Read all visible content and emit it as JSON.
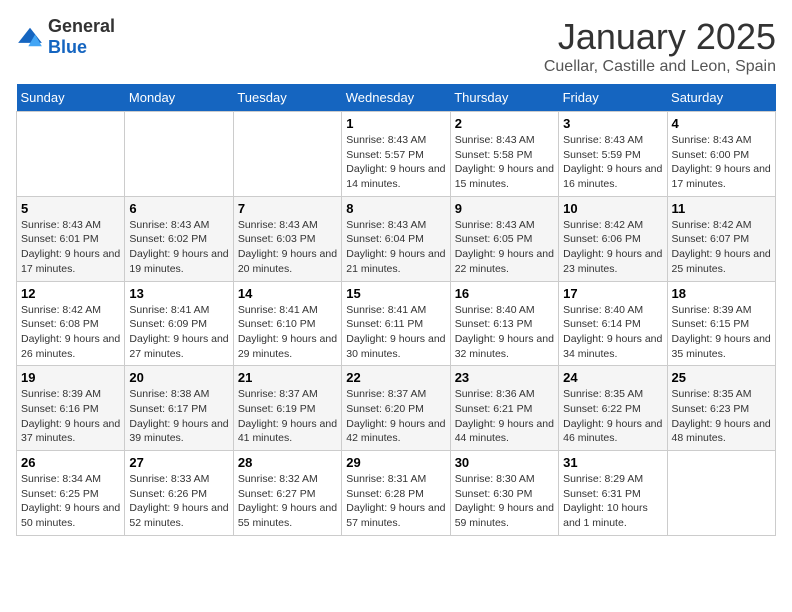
{
  "header": {
    "logo_general": "General",
    "logo_blue": "Blue",
    "month": "January 2025",
    "location": "Cuellar, Castille and Leon, Spain"
  },
  "weekdays": [
    "Sunday",
    "Monday",
    "Tuesday",
    "Wednesday",
    "Thursday",
    "Friday",
    "Saturday"
  ],
  "weeks": [
    [
      {
        "day": "",
        "info": ""
      },
      {
        "day": "",
        "info": ""
      },
      {
        "day": "",
        "info": ""
      },
      {
        "day": "1",
        "info": "Sunrise: 8:43 AM\nSunset: 5:57 PM\nDaylight: 9 hours and 14 minutes."
      },
      {
        "day": "2",
        "info": "Sunrise: 8:43 AM\nSunset: 5:58 PM\nDaylight: 9 hours and 15 minutes."
      },
      {
        "day": "3",
        "info": "Sunrise: 8:43 AM\nSunset: 5:59 PM\nDaylight: 9 hours and 16 minutes."
      },
      {
        "day": "4",
        "info": "Sunrise: 8:43 AM\nSunset: 6:00 PM\nDaylight: 9 hours and 17 minutes."
      }
    ],
    [
      {
        "day": "5",
        "info": "Sunrise: 8:43 AM\nSunset: 6:01 PM\nDaylight: 9 hours and 17 minutes."
      },
      {
        "day": "6",
        "info": "Sunrise: 8:43 AM\nSunset: 6:02 PM\nDaylight: 9 hours and 19 minutes."
      },
      {
        "day": "7",
        "info": "Sunrise: 8:43 AM\nSunset: 6:03 PM\nDaylight: 9 hours and 20 minutes."
      },
      {
        "day": "8",
        "info": "Sunrise: 8:43 AM\nSunset: 6:04 PM\nDaylight: 9 hours and 21 minutes."
      },
      {
        "day": "9",
        "info": "Sunrise: 8:43 AM\nSunset: 6:05 PM\nDaylight: 9 hours and 22 minutes."
      },
      {
        "day": "10",
        "info": "Sunrise: 8:42 AM\nSunset: 6:06 PM\nDaylight: 9 hours and 23 minutes."
      },
      {
        "day": "11",
        "info": "Sunrise: 8:42 AM\nSunset: 6:07 PM\nDaylight: 9 hours and 25 minutes."
      }
    ],
    [
      {
        "day": "12",
        "info": "Sunrise: 8:42 AM\nSunset: 6:08 PM\nDaylight: 9 hours and 26 minutes."
      },
      {
        "day": "13",
        "info": "Sunrise: 8:41 AM\nSunset: 6:09 PM\nDaylight: 9 hours and 27 minutes."
      },
      {
        "day": "14",
        "info": "Sunrise: 8:41 AM\nSunset: 6:10 PM\nDaylight: 9 hours and 29 minutes."
      },
      {
        "day": "15",
        "info": "Sunrise: 8:41 AM\nSunset: 6:11 PM\nDaylight: 9 hours and 30 minutes."
      },
      {
        "day": "16",
        "info": "Sunrise: 8:40 AM\nSunset: 6:13 PM\nDaylight: 9 hours and 32 minutes."
      },
      {
        "day": "17",
        "info": "Sunrise: 8:40 AM\nSunset: 6:14 PM\nDaylight: 9 hours and 34 minutes."
      },
      {
        "day": "18",
        "info": "Sunrise: 8:39 AM\nSunset: 6:15 PM\nDaylight: 9 hours and 35 minutes."
      }
    ],
    [
      {
        "day": "19",
        "info": "Sunrise: 8:39 AM\nSunset: 6:16 PM\nDaylight: 9 hours and 37 minutes."
      },
      {
        "day": "20",
        "info": "Sunrise: 8:38 AM\nSunset: 6:17 PM\nDaylight: 9 hours and 39 minutes."
      },
      {
        "day": "21",
        "info": "Sunrise: 8:37 AM\nSunset: 6:19 PM\nDaylight: 9 hours and 41 minutes."
      },
      {
        "day": "22",
        "info": "Sunrise: 8:37 AM\nSunset: 6:20 PM\nDaylight: 9 hours and 42 minutes."
      },
      {
        "day": "23",
        "info": "Sunrise: 8:36 AM\nSunset: 6:21 PM\nDaylight: 9 hours and 44 minutes."
      },
      {
        "day": "24",
        "info": "Sunrise: 8:35 AM\nSunset: 6:22 PM\nDaylight: 9 hours and 46 minutes."
      },
      {
        "day": "25",
        "info": "Sunrise: 8:35 AM\nSunset: 6:23 PM\nDaylight: 9 hours and 48 minutes."
      }
    ],
    [
      {
        "day": "26",
        "info": "Sunrise: 8:34 AM\nSunset: 6:25 PM\nDaylight: 9 hours and 50 minutes."
      },
      {
        "day": "27",
        "info": "Sunrise: 8:33 AM\nSunset: 6:26 PM\nDaylight: 9 hours and 52 minutes."
      },
      {
        "day": "28",
        "info": "Sunrise: 8:32 AM\nSunset: 6:27 PM\nDaylight: 9 hours and 55 minutes."
      },
      {
        "day": "29",
        "info": "Sunrise: 8:31 AM\nSunset: 6:28 PM\nDaylight: 9 hours and 57 minutes."
      },
      {
        "day": "30",
        "info": "Sunrise: 8:30 AM\nSunset: 6:30 PM\nDaylight: 9 hours and 59 minutes."
      },
      {
        "day": "31",
        "info": "Sunrise: 8:29 AM\nSunset: 6:31 PM\nDaylight: 10 hours and 1 minute."
      },
      {
        "day": "",
        "info": ""
      }
    ]
  ]
}
